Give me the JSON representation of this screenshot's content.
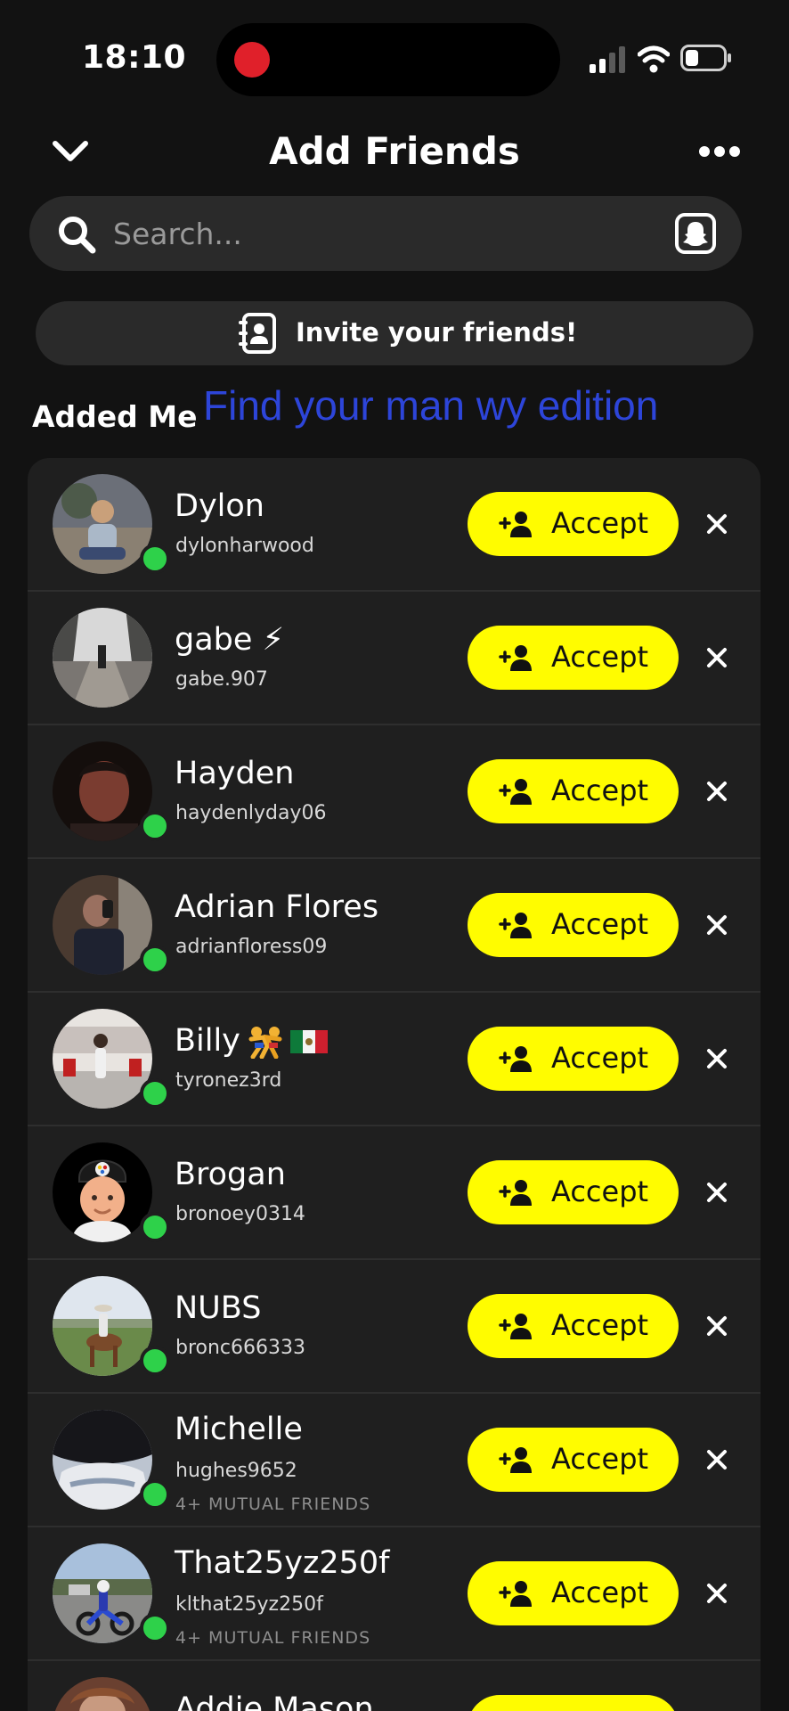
{
  "status_bar": {
    "time": "18:10"
  },
  "header": {
    "title": "Add Friends",
    "back_icon": "chevron-down-icon",
    "more_icon": "more-horizontal-icon"
  },
  "search": {
    "placeholder": "Search...",
    "value": ""
  },
  "invite": {
    "label": "Invite your friends!"
  },
  "section": {
    "title": "Added Me"
  },
  "overlay_caption": "Find your man wy edition",
  "accept_label": "Accept",
  "colors": {
    "background": "#121212",
    "card": "#1f1f1f",
    "accept": "#fffc00",
    "online": "#2ed14a",
    "caption": "#2d45d9",
    "record": "#e0202a"
  },
  "requests": [
    {
      "name": "Dylon",
      "username": "dylonharwood",
      "online": true,
      "mutual": ""
    },
    {
      "name": "gabe ⚡",
      "username": "gabe.907",
      "online": false,
      "mutual": ""
    },
    {
      "name": "Hayden",
      "username": "haydenlyday06",
      "online": true,
      "mutual": ""
    },
    {
      "name": "Adrian Flores",
      "username": "adrianfloress09",
      "online": true,
      "mutual": ""
    },
    {
      "name": "Billy",
      "username": "tyronez3rd",
      "online": true,
      "mutual": ""
    },
    {
      "name": "Brogan",
      "username": "bronoey0314",
      "online": true,
      "mutual": ""
    },
    {
      "name": "NUBS",
      "username": "bronc666333",
      "online": true,
      "mutual": ""
    },
    {
      "name": "Michelle",
      "username": "hughes9652",
      "online": true,
      "mutual": "4+ MUTUAL FRIENDS"
    },
    {
      "name": "That25yz250f",
      "username": "klthat25yz250f",
      "online": true,
      "mutual": "4+ MUTUAL FRIENDS"
    },
    {
      "name": "Addie Mason",
      "username": "",
      "online": false,
      "mutual": ""
    }
  ]
}
